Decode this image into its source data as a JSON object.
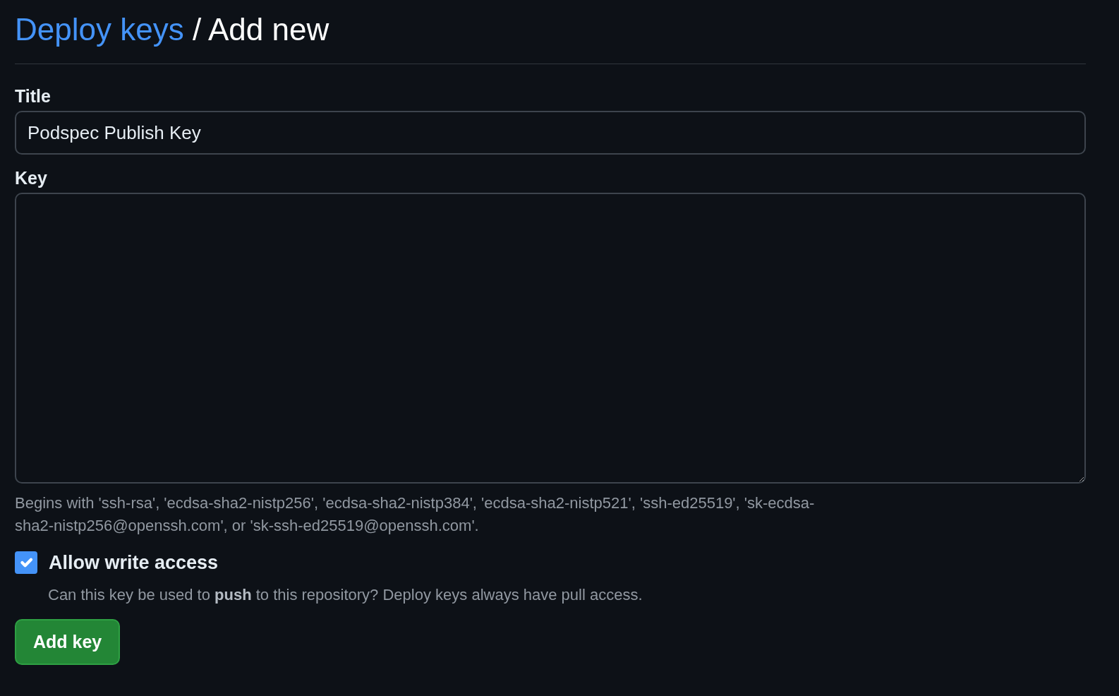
{
  "breadcrumb": {
    "link": "Deploy keys",
    "separator": "/",
    "current": "Add new"
  },
  "title_field": {
    "label": "Title",
    "value": "Podspec Publish Key"
  },
  "key_field": {
    "label": "Key",
    "help": "Begins with 'ssh-rsa', 'ecdsa-sha2-nistp256', 'ecdsa-sha2-nistp384', 'ecdsa-sha2-nistp521', 'ssh-ed25519', 'sk-ecdsa-sha2-nistp256@openssh.com', or 'sk-ssh-ed25519@openssh.com'."
  },
  "write_access": {
    "label": "Allow write access",
    "checked": true,
    "description": "Can this key be used to **push** to this repository? Deploy keys always have pull access."
  },
  "submit_button": {
    "label": "Add key"
  }
}
